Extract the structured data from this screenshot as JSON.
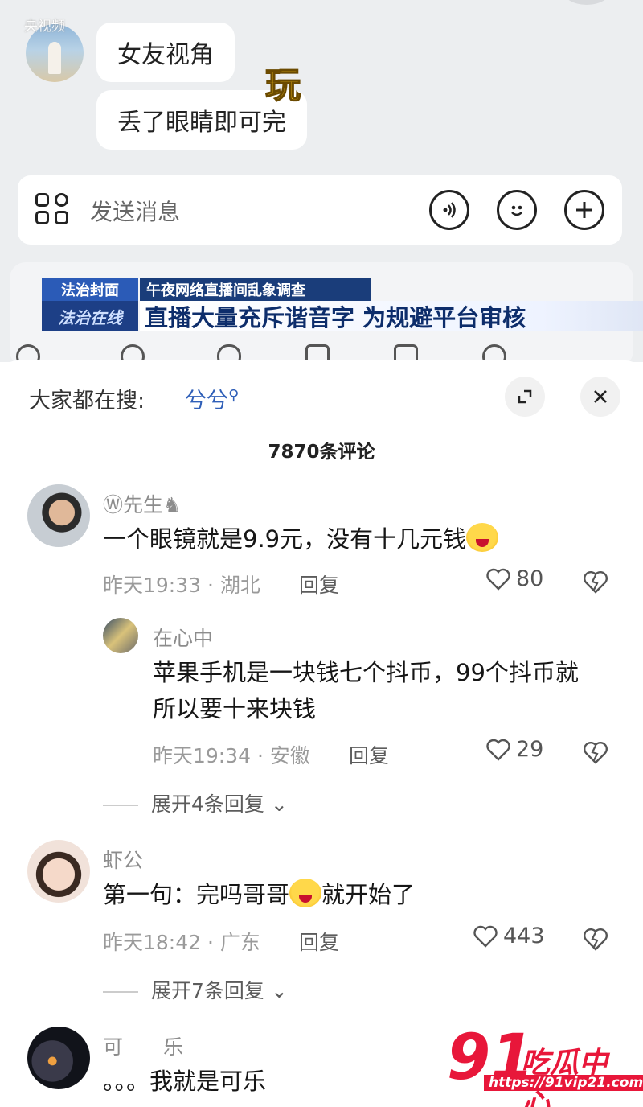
{
  "video": {
    "watermark": "央视频",
    "chat": {
      "bubble1": "女友视角",
      "bubble2": "丢了眼睛即可完",
      "overlay_word": "玩"
    },
    "composer": {
      "placeholder": "发送消息",
      "icons": [
        "apps-grid-icon",
        "voice-icon",
        "emoji-icon",
        "plus-icon"
      ]
    },
    "news": {
      "program_label": "法治封面",
      "channel_label": "法治在线",
      "topic": "午夜网络直播间乱象调查",
      "headline": "直播大量充斥谐音字 为规避平台审核"
    }
  },
  "sheet": {
    "search_hint": "大家都在搜:",
    "search_term": "兮兮",
    "comment_count": "7870条评论",
    "comments": [
      {
        "name": "Ⓦ先生♞",
        "text": "一个眼镜就是9.9元，没有十几元钱",
        "meta": "昨天19:33 · 湖北",
        "reply_label": "回复",
        "likes": "80",
        "replies": [
          {
            "name": "在心中",
            "text_line1": "苹果手机是一块钱七个抖币，99个抖币就",
            "text_line2": "所以要十来块钱",
            "meta": "昨天19:34 · 安徽",
            "reply_label": "回复",
            "likes": "29"
          }
        ],
        "expand": "展开4条回复"
      },
      {
        "name": "虾公",
        "text_before": "第一句：完吗哥哥",
        "text_after": "就开始了",
        "meta": "昨天18:42 · 广东",
        "reply_label": "回复",
        "likes": "443",
        "expand": "展开7条回复"
      },
      {
        "name": "可　　乐",
        "text": "。。。我就是可乐"
      }
    ]
  },
  "watermark91": {
    "number": "91",
    "text": "吃瓜中心",
    "url": "https://91vip21.com"
  },
  "colors": {
    "link_blue": "#2f5fb8",
    "watermark_red": "#e8173a",
    "news_blue": "#1a3d7a"
  }
}
